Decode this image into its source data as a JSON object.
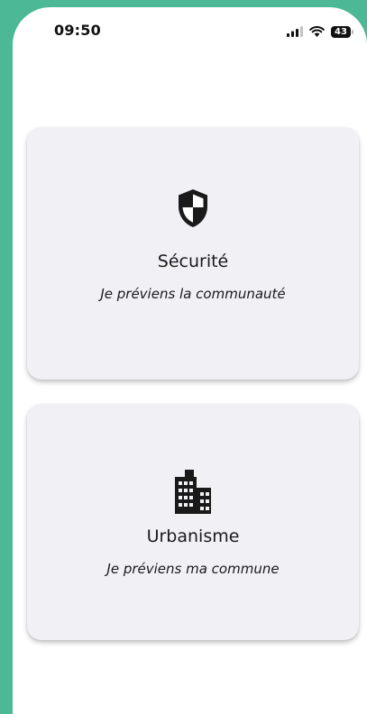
{
  "status_bar": {
    "time": "09:50",
    "battery": "43",
    "icons": [
      "signal-icon",
      "wifi-icon",
      "battery-icon"
    ]
  },
  "cards": {
    "security": {
      "icon": "shield-icon",
      "title": "Sécurité",
      "subtitle": "Je préviens la communauté"
    },
    "urbanism": {
      "icon": "building-icon",
      "title": "Urbanisme",
      "subtitle": "Je préviens ma commune"
    }
  },
  "colors": {
    "background_accent": "#4cb896",
    "card_background": "#f1f1f5",
    "text": "#1a1a1a"
  }
}
